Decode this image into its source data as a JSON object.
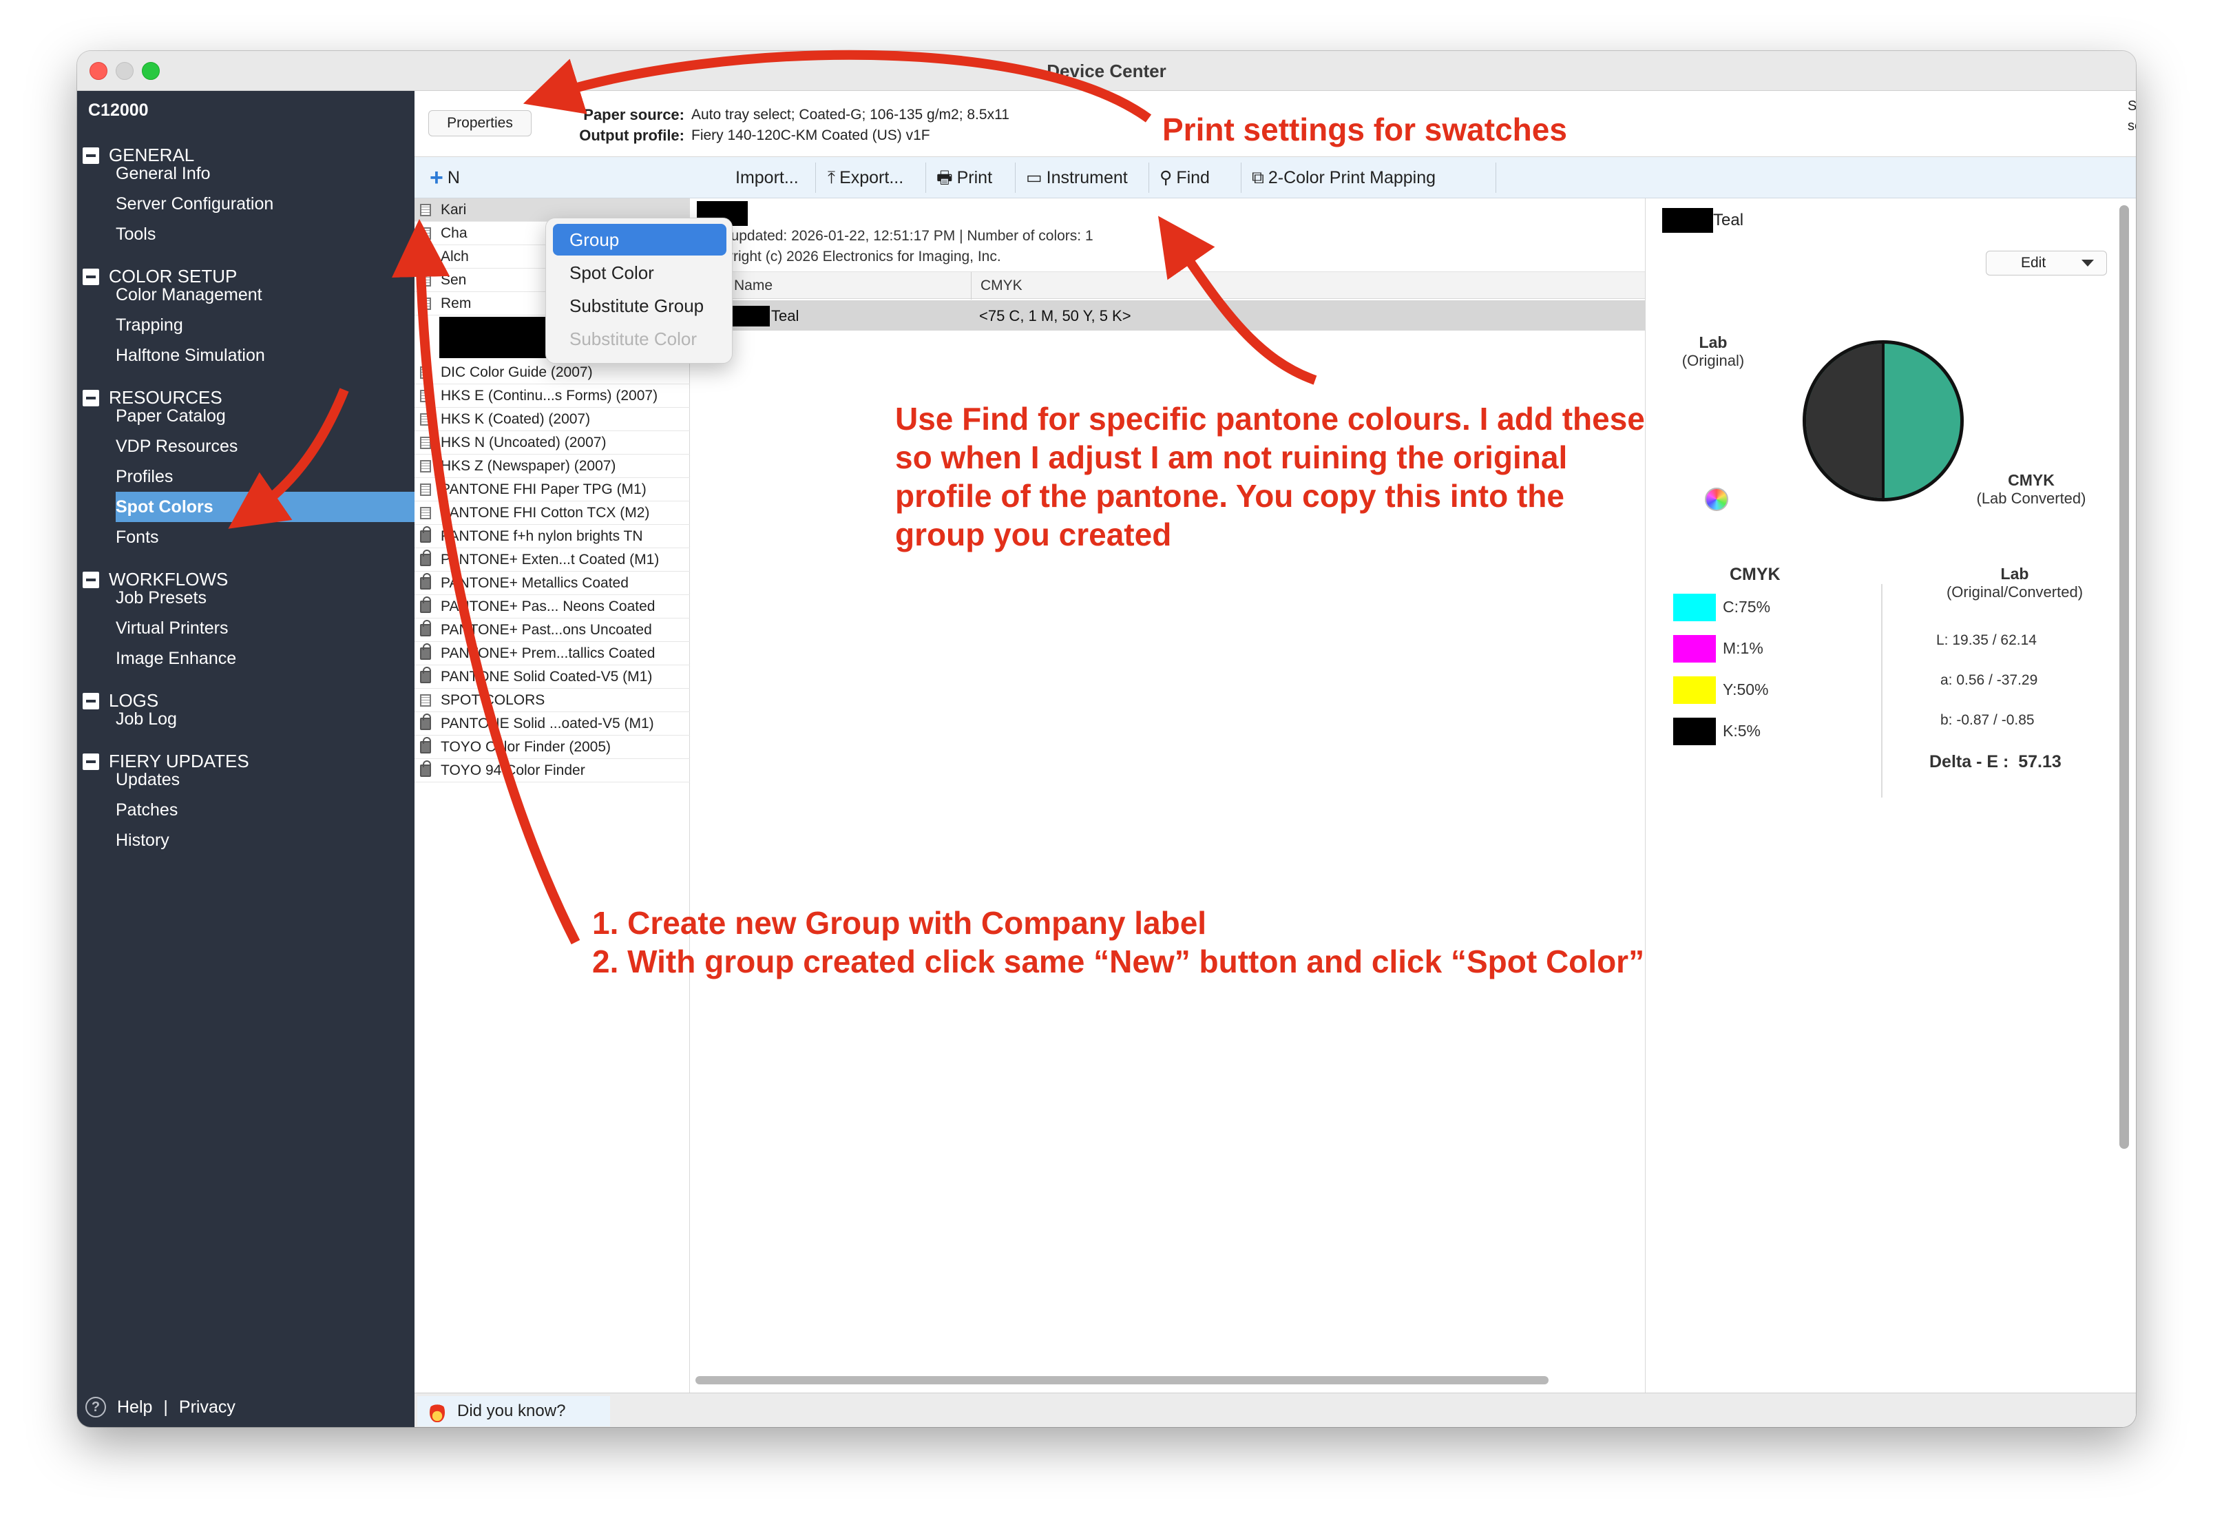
{
  "window": {
    "title": "Device Center"
  },
  "sidebar": {
    "device": "C12000",
    "groups": [
      {
        "label": "GENERAL",
        "items": [
          "General Info",
          "Server Configuration",
          "Tools"
        ]
      },
      {
        "label": "COLOR SETUP",
        "items": [
          "Color Management",
          "Trapping",
          "Halftone Simulation"
        ]
      },
      {
        "label": "RESOURCES",
        "items": [
          "Paper Catalog",
          "VDP Resources",
          "Profiles",
          "Spot Colors",
          "Fonts"
        ]
      },
      {
        "label": "WORKFLOWS",
        "items": [
          "Job Presets",
          "Virtual Printers",
          "Image Enhance"
        ]
      },
      {
        "label": "LOGS",
        "items": [
          "Job Log"
        ]
      },
      {
        "label": "FIERY UPDATES",
        "items": [
          "Updates",
          "Patches",
          "History"
        ]
      }
    ],
    "selected": "Spot Colors",
    "footer": {
      "help": "Help",
      "divider": "|",
      "privacy": "Privacy"
    }
  },
  "properties": {
    "button": "Properties",
    "paper_source_label": "Paper source:",
    "paper_source": "Auto tray select; Coated-G; 106-135 g/m2; 8.5x11",
    "output_profile_label": "Output profile:",
    "output_profile": "Fiery 140-120C-KM Coated (US) v1F",
    "hint": "Set the property settings to match the intended print settings before editing a spot color."
  },
  "toolbar": {
    "new": "N",
    "import": "Import...",
    "export": "Export...",
    "print": "Print",
    "instrument": "Instrument",
    "find": "Find",
    "mapping": "2-Color Print Mapping"
  },
  "new_menu": {
    "items": [
      "Group",
      "Spot Color",
      "Substitute Group",
      "Substitute Color"
    ],
    "highlighted": "Group",
    "disabled": "Substitute Color"
  },
  "libraries": {
    "partial_rows": [
      "Kari",
      "Cha",
      "Alch",
      "Sen",
      "Rem"
    ],
    "rows": [
      "DIC Color Guide (2007)",
      "HKS E (Continu...s Forms) (2007)",
      "HKS K (Coated) (2007)",
      "HKS N (Uncoated) (2007)",
      "HKS Z (Newspaper) (2007)",
      "PANTONE FHI Paper TPG (M1)",
      "PANTONE FHI Cotton TCX (M2)",
      "PANTONE f+h nylon brights TN",
      "PANTONE+ Exten...t Coated (M1)",
      "PANTONE+ Metallics Coated",
      "PANTONE+ Pas... Neons Coated",
      "PANTONE+ Past...ons Uncoated",
      "PANTONE+ Prem...tallics Coated",
      "PANTONE Solid Coated-V5 (M1)",
      "SPOT COLORS",
      "PANTONE Solid ...oated-V5 (M1)",
      "TOYO Color Finder (2005)",
      "TOYO 94 Color Finder"
    ]
  },
  "details": {
    "last_updated": "Last updated: 2026-01-22, 12:51:17 PM | Number of colors: 1",
    "copyright": "Copyright (c) 2026 Electronics for Imaging, Inc.",
    "col_name": "Name",
    "col_cmyk": "CMYK",
    "row": {
      "name": "Teal",
      "cmyk": "<75 C, 1 M, 50 Y, 5 K>",
      "swatch": "#38ac8c"
    }
  },
  "color_panel": {
    "name": "Teal",
    "edit": "Edit",
    "lab_title": "Lab",
    "lab_sub": "(Original)",
    "cmyk_title": "CMYK",
    "cmyk_sub": "(Lab Converted)",
    "original_color": "#333333",
    "converted_color": "#38ac8c",
    "cmyk_header": "CMYK",
    "lab_header": "Lab",
    "lab_header_sub": "(Original/Converted)",
    "cmyk": [
      {
        "label": "C:75%",
        "color": "#00ffff"
      },
      {
        "label": "M:1%",
        "color": "#ff00ff"
      },
      {
        "label": "Y:50%",
        "color": "#ffff00"
      },
      {
        "label": "K:5%",
        "color": "#000000"
      }
    ],
    "lab": {
      "L": "L:  19.35 / 62.14",
      "a": "a:  0.56 / -37.29",
      "b": "b:  -0.87 / -0.85"
    },
    "delta_label": "Delta - E :",
    "delta_value": "57.13"
  },
  "status": {
    "did_you_know": "Did you know?"
  },
  "annotations": {
    "print_settings": "Print settings for swatches",
    "find_note": [
      "Use Find for specific pantone colours. I add these",
      "so when I adjust I am not ruining the original",
      "profile of the pantone. You copy this into the",
      "group you created"
    ],
    "steps": [
      "1. Create new Group with Company label",
      "2. With group created click same “New” button and click “Spot Color”"
    ],
    "color": "#e2301a"
  }
}
